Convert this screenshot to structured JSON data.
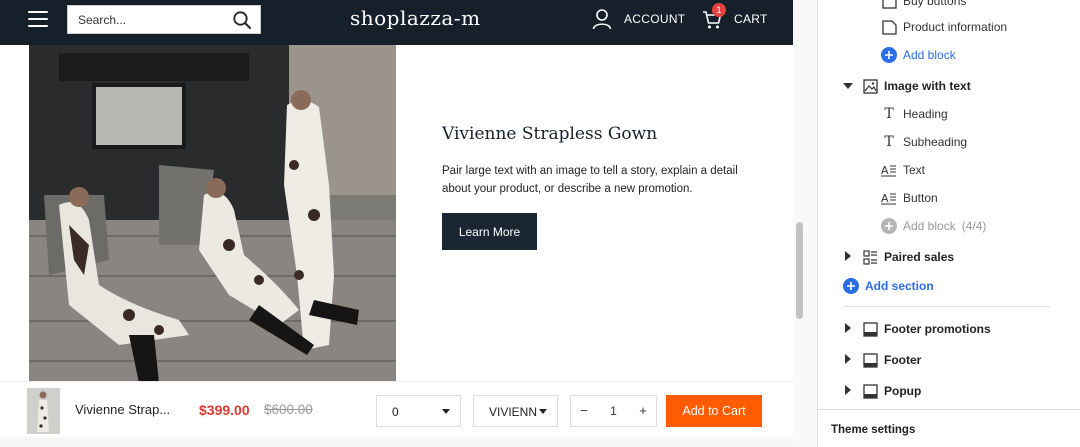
{
  "header": {
    "search_placeholder": "Search...",
    "brand": "shoplazza-m",
    "account_label": "ACCOUNT",
    "cart_label": "CART",
    "cart_count": "1"
  },
  "section": {
    "heading": "Vivienne Strapless Gown",
    "text": "Pair large text with an image to tell a story, explain a detail about your product, or describe a new promotion.",
    "button_label": "Learn More"
  },
  "sticky_bar": {
    "product_name": "Vivienne Strap...",
    "price": "$399.00",
    "old_price": "$600.00",
    "size_value": "0",
    "variant_value": "VIVIENN",
    "qty_minus": "−",
    "qty_value": "1",
    "qty_plus": "+",
    "add_to_cart_label": "Add to Cart"
  },
  "sidebar": {
    "partial_top": "Buy buttons",
    "product_information": "Product information",
    "add_block": "Add block",
    "image_with_text": "Image with text",
    "blocks": [
      {
        "label": "Heading",
        "icon": "heading-icon"
      },
      {
        "label": "Subheading",
        "icon": "subheading-icon"
      },
      {
        "label": "Text",
        "icon": "text-block-icon"
      },
      {
        "label": "Button",
        "icon": "button-block-icon"
      }
    ],
    "add_block_limit": "Add block",
    "add_block_count": "(4/4)",
    "paired_sales": "Paired sales",
    "add_section": "Add section",
    "footer_promotions": "Footer promotions",
    "footer": "Footer",
    "popup": "Popup",
    "theme_settings": "Theme settings"
  },
  "colors": {
    "header_bg": "#15202b",
    "accent_blue": "#2b6de6",
    "price_red": "#d93a32",
    "add_to_cart_orange": "#ff5b00",
    "badge_red": "#e44141"
  }
}
